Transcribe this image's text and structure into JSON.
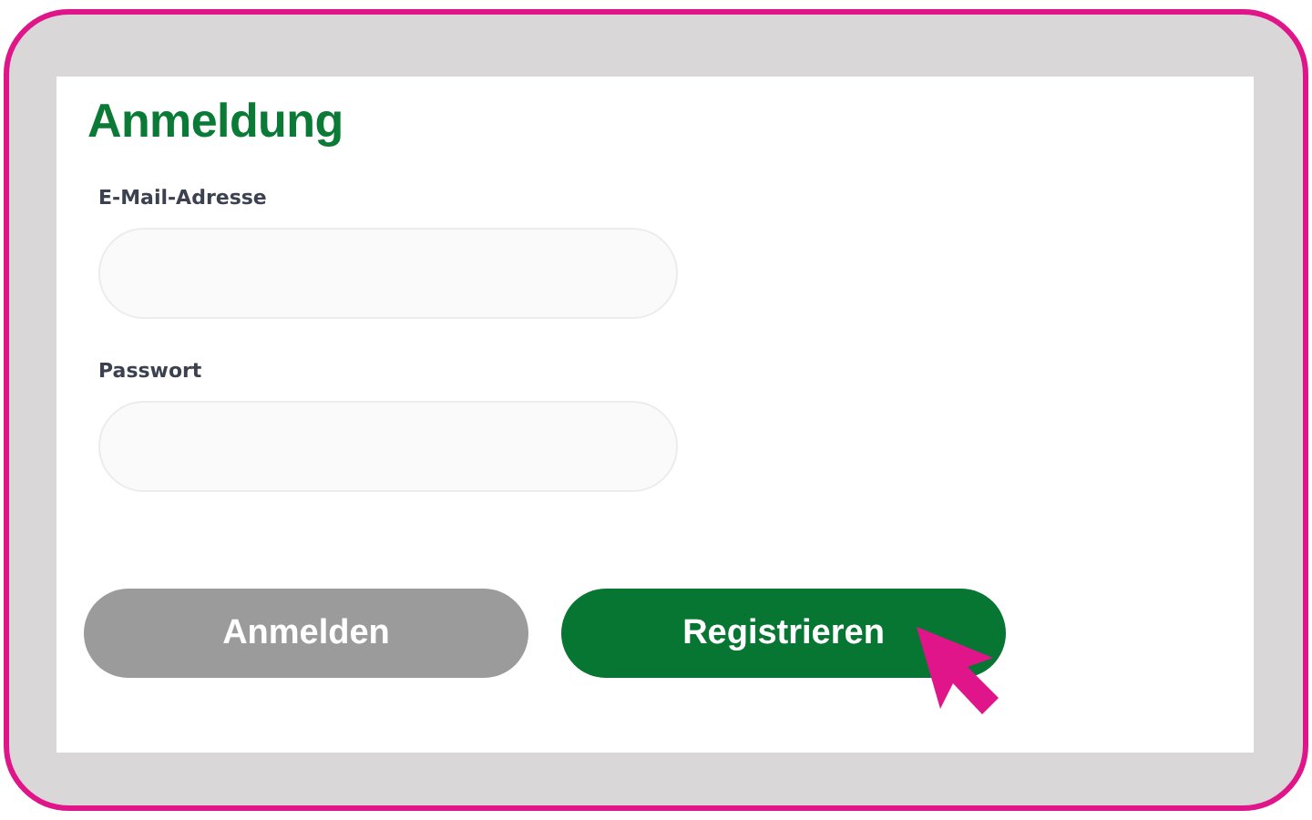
{
  "form": {
    "title": "Anmeldung",
    "fields": [
      {
        "label": "E-Mail-Adresse"
      },
      {
        "label": "Passwort"
      }
    ],
    "buttons": [
      {
        "label": "Anmelden",
        "disabled": true
      },
      {
        "label": "Registrieren",
        "disabled": false
      }
    ]
  }
}
